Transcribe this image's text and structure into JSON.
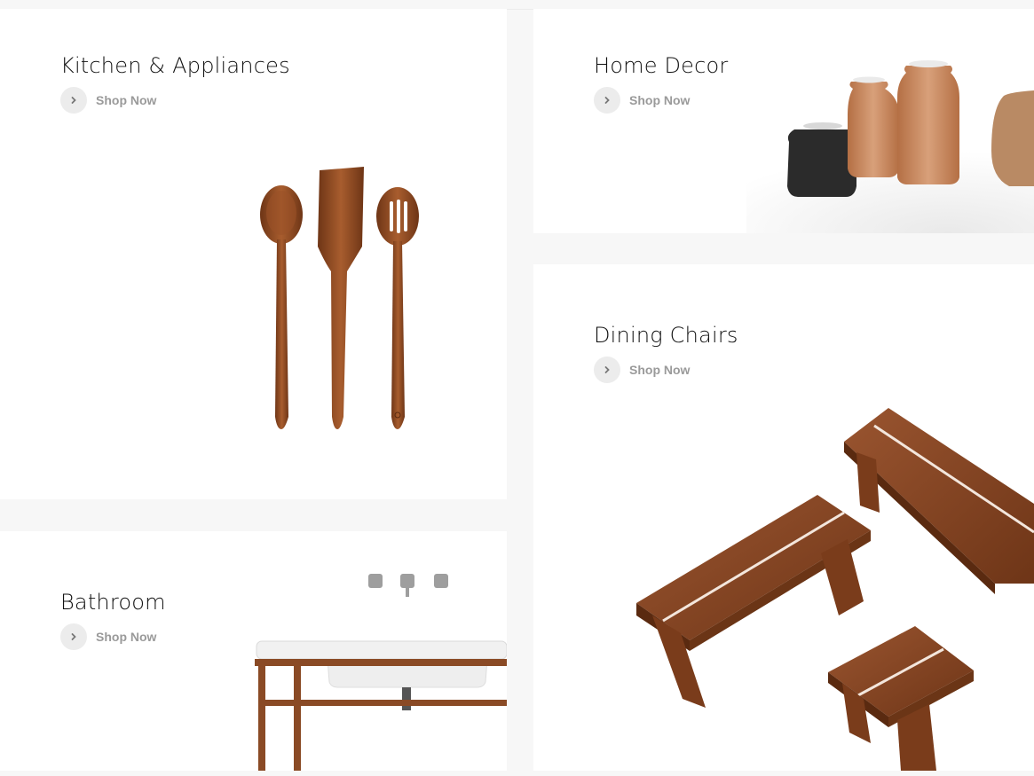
{
  "categories": [
    {
      "id": "kitchen",
      "title": "Kitchen & Appliances",
      "cta": "Shop Now"
    },
    {
      "id": "home",
      "title": "Home Decor",
      "cta": "Shop Now"
    },
    {
      "id": "dining",
      "title": "Dining Chairs",
      "cta": "Shop Now"
    },
    {
      "id": "bath",
      "title": "Bathroom",
      "cta": "Shop Now"
    }
  ],
  "icons": {
    "cta_icon": "chevron-right-icon"
  },
  "colors": {
    "wood": "#8a4a25",
    "wood_light": "#c98a5c",
    "ceramic_dark": "#2b2b2b",
    "cta_text": "#9a9a9a",
    "cta_circle": "#ececec"
  }
}
